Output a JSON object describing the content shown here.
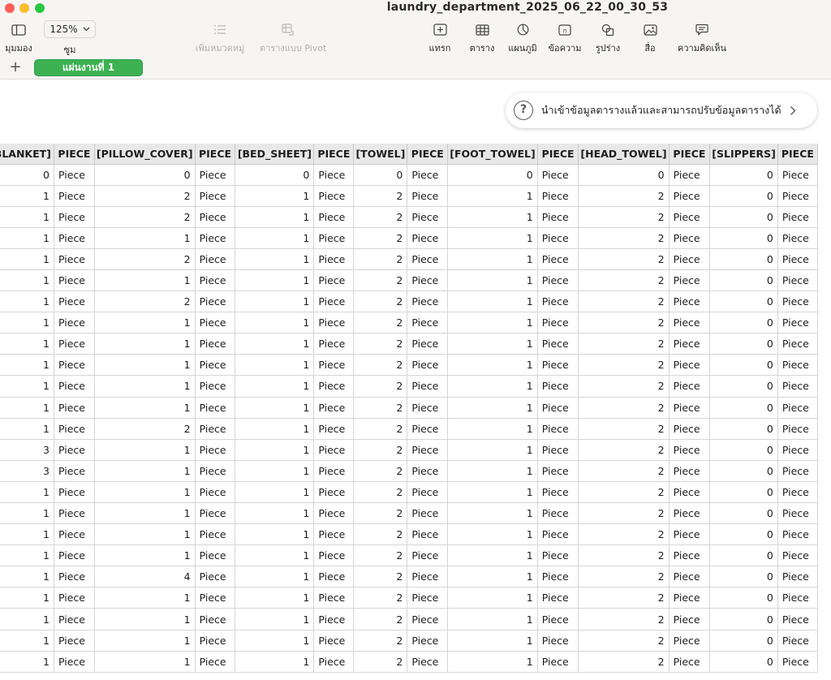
{
  "window": {
    "title": "laundry_department_2025_06_22_00_30_53"
  },
  "toolbar": {
    "view_label": "มุมมอง",
    "zoom_value": "125%",
    "zoom_label": "ซูม",
    "add_category_label": "เพิ่มหมวดหมู่",
    "pivot_label": "ตารางแบบ Pivot",
    "insert_label": "แทรก",
    "table_label": "ตาราง",
    "chart_label": "แผนภูมิ",
    "text_label": "ข้อความ",
    "shape_label": "รูปร่าง",
    "media_label": "สื่อ",
    "comment_label": "ความคิดเห็น"
  },
  "sheets": {
    "active": "แผ่นงานที่ 1"
  },
  "import_tip": {
    "text": "นำเข้าข้อมูลตารางแล้วและสามารถปรับข้อมูลตารางได้"
  },
  "table": {
    "headers": [
      "[BLANKET]",
      "PIECE",
      "[PILLOW_COVER]",
      "PIECE",
      "[BED_SHEET]",
      "PIECE",
      "[TOWEL]",
      "PIECE",
      "[FOOT_TOWEL]",
      "PIECE",
      "[HEAD_TOWEL]",
      "PIECE",
      "[SLIPPERS]",
      "PIECE"
    ],
    "rows": [
      [
        "0",
        "Piece",
        "0",
        "Piece",
        "0",
        "Piece",
        "0",
        "Piece",
        "0",
        "Piece",
        "0",
        "Piece",
        "0",
        "Piece"
      ],
      [
        "1",
        "Piece",
        "2",
        "Piece",
        "1",
        "Piece",
        "2",
        "Piece",
        "1",
        "Piece",
        "2",
        "Piece",
        "0",
        "Piece"
      ],
      [
        "1",
        "Piece",
        "2",
        "Piece",
        "1",
        "Piece",
        "2",
        "Piece",
        "1",
        "Piece",
        "2",
        "Piece",
        "0",
        "Piece"
      ],
      [
        "1",
        "Piece",
        "1",
        "Piece",
        "1",
        "Piece",
        "2",
        "Piece",
        "1",
        "Piece",
        "2",
        "Piece",
        "0",
        "Piece"
      ],
      [
        "1",
        "Piece",
        "2",
        "Piece",
        "1",
        "Piece",
        "2",
        "Piece",
        "1",
        "Piece",
        "2",
        "Piece",
        "0",
        "Piece"
      ],
      [
        "1",
        "Piece",
        "1",
        "Piece",
        "1",
        "Piece",
        "2",
        "Piece",
        "1",
        "Piece",
        "2",
        "Piece",
        "0",
        "Piece"
      ],
      [
        "1",
        "Piece",
        "2",
        "Piece",
        "1",
        "Piece",
        "2",
        "Piece",
        "1",
        "Piece",
        "2",
        "Piece",
        "0",
        "Piece"
      ],
      [
        "1",
        "Piece",
        "1",
        "Piece",
        "1",
        "Piece",
        "2",
        "Piece",
        "1",
        "Piece",
        "2",
        "Piece",
        "0",
        "Piece"
      ],
      [
        "1",
        "Piece",
        "1",
        "Piece",
        "1",
        "Piece",
        "2",
        "Piece",
        "1",
        "Piece",
        "2",
        "Piece",
        "0",
        "Piece"
      ],
      [
        "1",
        "Piece",
        "1",
        "Piece",
        "1",
        "Piece",
        "2",
        "Piece",
        "1",
        "Piece",
        "2",
        "Piece",
        "0",
        "Piece"
      ],
      [
        "1",
        "Piece",
        "1",
        "Piece",
        "1",
        "Piece",
        "2",
        "Piece",
        "1",
        "Piece",
        "2",
        "Piece",
        "0",
        "Piece"
      ],
      [
        "1",
        "Piece",
        "1",
        "Piece",
        "1",
        "Piece",
        "2",
        "Piece",
        "1",
        "Piece",
        "2",
        "Piece",
        "0",
        "Piece"
      ],
      [
        "1",
        "Piece",
        "2",
        "Piece",
        "1",
        "Piece",
        "2",
        "Piece",
        "1",
        "Piece",
        "2",
        "Piece",
        "0",
        "Piece"
      ],
      [
        "3",
        "Piece",
        "1",
        "Piece",
        "1",
        "Piece",
        "2",
        "Piece",
        "1",
        "Piece",
        "2",
        "Piece",
        "0",
        "Piece"
      ],
      [
        "3",
        "Piece",
        "1",
        "Piece",
        "1",
        "Piece",
        "2",
        "Piece",
        "1",
        "Piece",
        "2",
        "Piece",
        "0",
        "Piece"
      ],
      [
        "1",
        "Piece",
        "1",
        "Piece",
        "1",
        "Piece",
        "2",
        "Piece",
        "1",
        "Piece",
        "2",
        "Piece",
        "0",
        "Piece"
      ],
      [
        "1",
        "Piece",
        "1",
        "Piece",
        "1",
        "Piece",
        "2",
        "Piece",
        "1",
        "Piece",
        "2",
        "Piece",
        "0",
        "Piece"
      ],
      [
        "1",
        "Piece",
        "1",
        "Piece",
        "1",
        "Piece",
        "2",
        "Piece",
        "1",
        "Piece",
        "2",
        "Piece",
        "0",
        "Piece"
      ],
      [
        "1",
        "Piece",
        "1",
        "Piece",
        "1",
        "Piece",
        "2",
        "Piece",
        "1",
        "Piece",
        "2",
        "Piece",
        "0",
        "Piece"
      ],
      [
        "1",
        "Piece",
        "4",
        "Piece",
        "1",
        "Piece",
        "2",
        "Piece",
        "1",
        "Piece",
        "2",
        "Piece",
        "0",
        "Piece"
      ],
      [
        "1",
        "Piece",
        "1",
        "Piece",
        "1",
        "Piece",
        "2",
        "Piece",
        "1",
        "Piece",
        "2",
        "Piece",
        "0",
        "Piece"
      ],
      [
        "1",
        "Piece",
        "1",
        "Piece",
        "1",
        "Piece",
        "2",
        "Piece",
        "1",
        "Piece",
        "2",
        "Piece",
        "0",
        "Piece"
      ],
      [
        "1",
        "Piece",
        "1",
        "Piece",
        "1",
        "Piece",
        "2",
        "Piece",
        "1",
        "Piece",
        "2",
        "Piece",
        "0",
        "Piece"
      ],
      [
        "1",
        "Piece",
        "1",
        "Piece",
        "1",
        "Piece",
        "2",
        "Piece",
        "1",
        "Piece",
        "2",
        "Piece",
        "0",
        "Piece"
      ]
    ]
  }
}
